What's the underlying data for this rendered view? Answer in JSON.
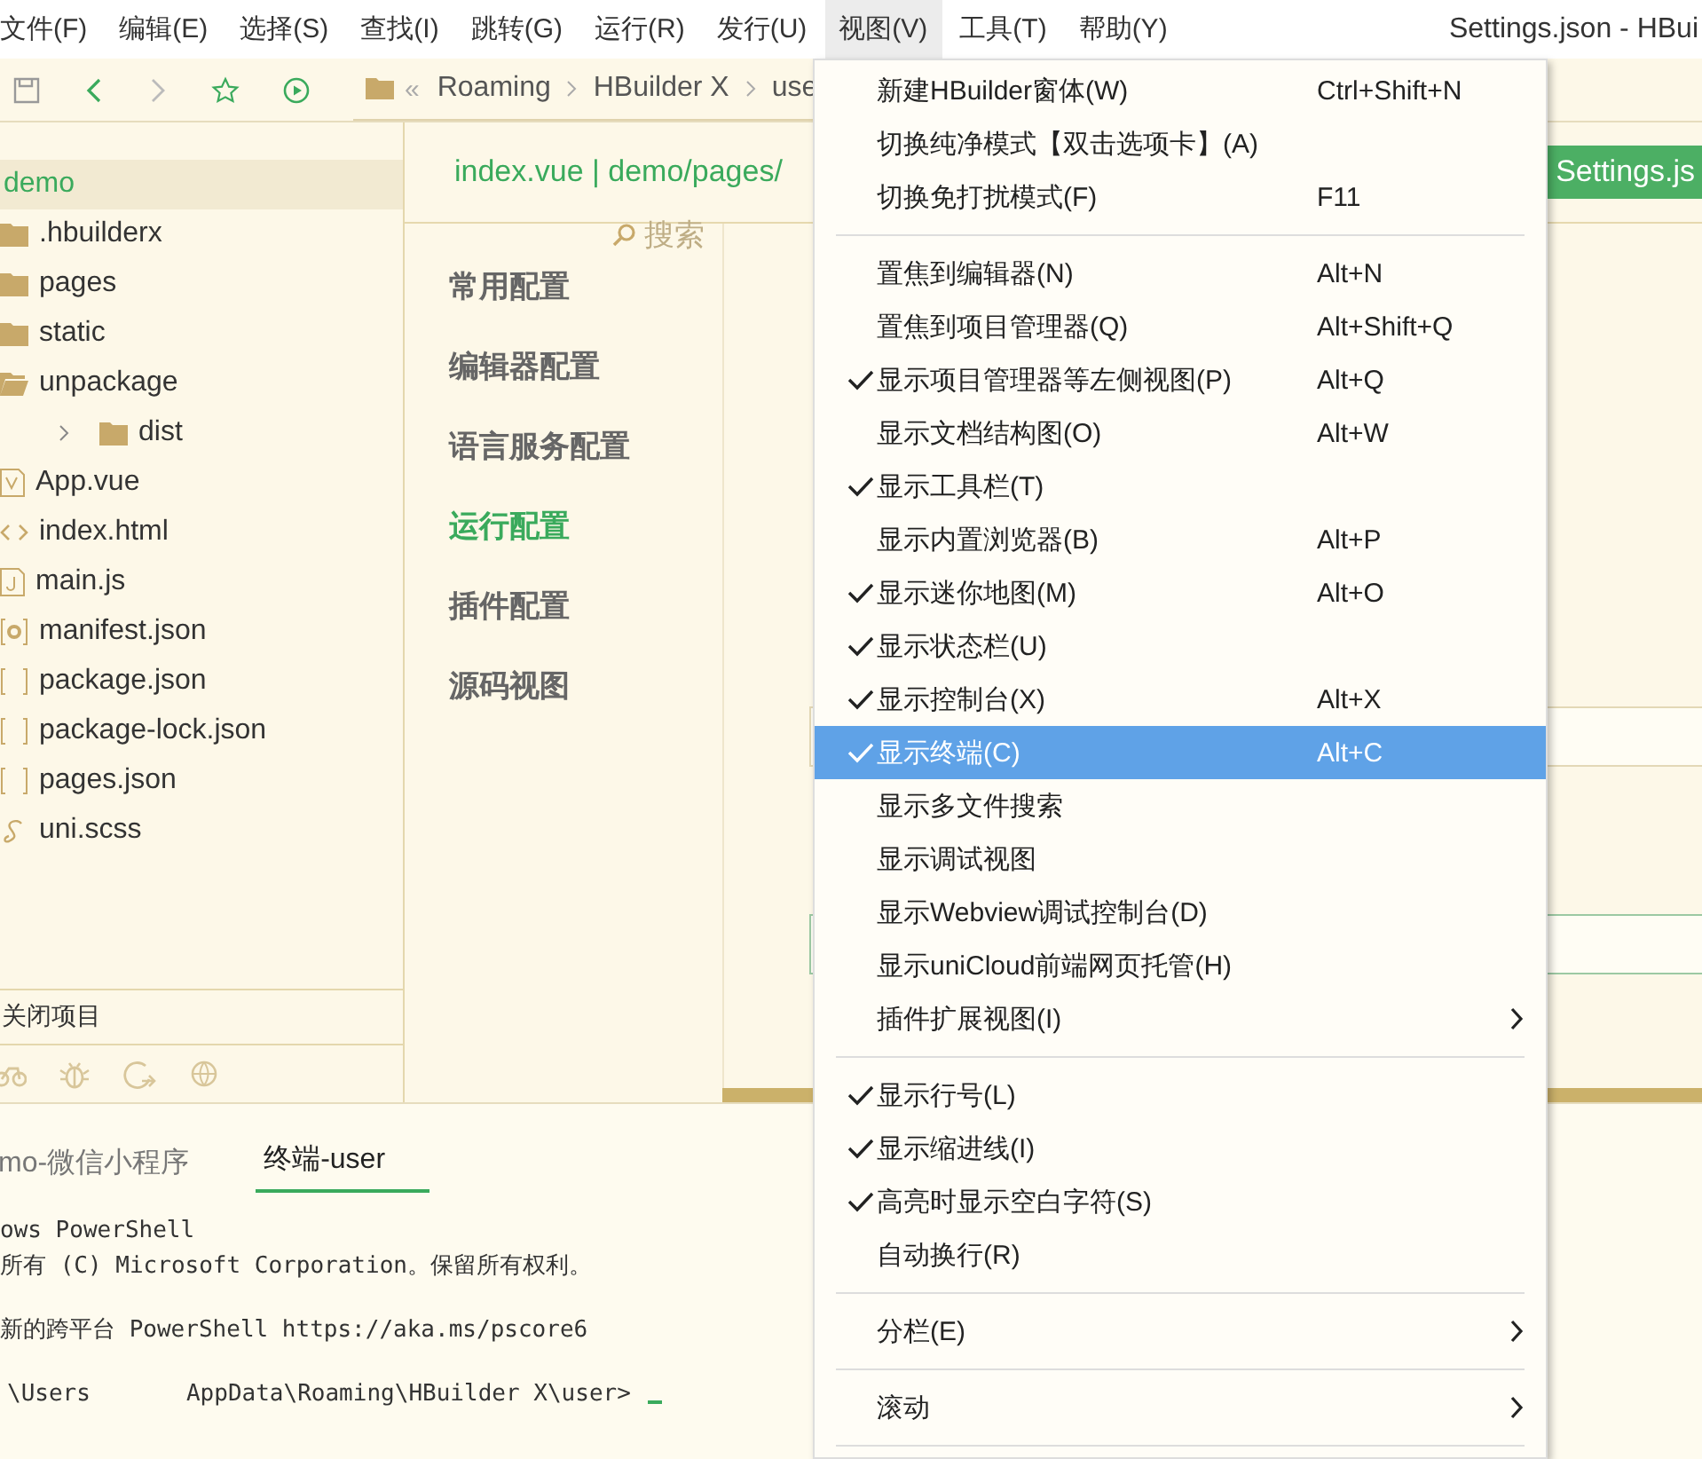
{
  "menubar": {
    "items": [
      {
        "label": "文件(F)",
        "selected": false
      },
      {
        "label": "编辑(E)",
        "selected": false
      },
      {
        "label": "选择(S)",
        "selected": false
      },
      {
        "label": "查找(I)",
        "selected": false
      },
      {
        "label": "跳转(G)",
        "selected": false
      },
      {
        "label": "运行(R)",
        "selected": false
      },
      {
        "label": "发行(U)",
        "selected": false
      },
      {
        "label": "视图(V)",
        "selected": true
      },
      {
        "label": "工具(T)",
        "selected": false
      },
      {
        "label": "帮助(Y)",
        "selected": false
      }
    ],
    "window_title": "Settings.json - HBui"
  },
  "toolbar": {
    "breadcrumb_mark": "«",
    "breadcrumb": [
      "Roaming",
      "HBuilder X",
      "use"
    ]
  },
  "sidebar": {
    "tree": [
      {
        "label": "demo",
        "kind": "project",
        "selected": true,
        "children": [
          {
            "label": ".hbuilderx",
            "kind": "folder",
            "selected": false
          },
          {
            "label": "pages",
            "kind": "folder",
            "selected": false
          },
          {
            "label": "static",
            "kind": "folder",
            "selected": false
          },
          {
            "label": "unpackage",
            "kind": "folder-open",
            "selected": false,
            "children": [
              {
                "label": "dist",
                "kind": "folder",
                "selected": false
              }
            ]
          },
          {
            "label": "App.vue",
            "kind": "vue",
            "selected": false
          },
          {
            "label": "index.html",
            "kind": "html",
            "selected": false
          },
          {
            "label": "main.js",
            "kind": "js",
            "selected": false
          },
          {
            "label": "manifest.json",
            "kind": "manifest",
            "selected": false
          },
          {
            "label": "package.json",
            "kind": "json",
            "selected": false
          },
          {
            "label": "package-lock.json",
            "kind": "json",
            "selected": false
          },
          {
            "label": "pages.json",
            "kind": "json",
            "selected": false
          },
          {
            "label": "uni.scss",
            "kind": "scss",
            "selected": false
          }
        ]
      }
    ],
    "close_project": "关闭项目"
  },
  "editor_tabs": [
    {
      "label": "index.vue | demo/pages/",
      "selected": false
    },
    {
      "label": "Settings.js",
      "selected": true
    }
  ],
  "settings_nav": {
    "search": "搜索",
    "items": [
      {
        "label": "常用配置",
        "selected": false
      },
      {
        "label": "编辑器配置",
        "selected": false
      },
      {
        "label": "语言服务配置",
        "selected": false
      },
      {
        "label": "运行配置",
        "selected": true
      },
      {
        "label": "插件配置",
        "selected": false
      },
      {
        "label": "源码视图",
        "selected": false
      }
    ]
  },
  "panel": {
    "tabs": [
      {
        "label": "mo-微信小程序",
        "selected": false
      },
      {
        "label": "终端-user",
        "selected": true
      }
    ],
    "terminal_lines": [
      "ows PowerShell",
      "所有 (C) Microsoft Corporation。保留所有权利。",
      "新的跨平台 PowerShell https://aka.ms/pscore6"
    ],
    "prompt_start": "\\Users",
    "prompt_end": "AppData\\Roaming\\HBuilder X\\user>"
  },
  "view_menu": {
    "items": [
      {
        "kind": "item",
        "label": "新建HBuilder窗体(W)",
        "shortcut": "Ctrl+Shift+N",
        "checked": false,
        "selected": false
      },
      {
        "kind": "item",
        "label": "切换纯净模式【双击选项卡】(A)",
        "checked": false,
        "selected": false
      },
      {
        "kind": "item",
        "label": "切换免打扰模式(F)",
        "shortcut": "F11",
        "checked": false,
        "selected": false
      },
      {
        "kind": "separator"
      },
      {
        "kind": "item",
        "label": "置焦到编辑器(N)",
        "shortcut": "Alt+N",
        "checked": false,
        "selected": false
      },
      {
        "kind": "item",
        "label": "置焦到项目管理器(Q)",
        "shortcut": "Alt+Shift+Q",
        "checked": false,
        "selected": false
      },
      {
        "kind": "item",
        "label": "显示项目管理器等左侧视图(P)",
        "shortcut": "Alt+Q",
        "checked": true,
        "selected": false
      },
      {
        "kind": "item",
        "label": "显示文档结构图(O)",
        "shortcut": "Alt+W",
        "checked": false,
        "selected": false
      },
      {
        "kind": "item",
        "label": "显示工具栏(T)",
        "checked": true,
        "selected": false
      },
      {
        "kind": "item",
        "label": "显示内置浏览器(B)",
        "shortcut": "Alt+P",
        "checked": false,
        "selected": false
      },
      {
        "kind": "item",
        "label": "显示迷你地图(M)",
        "shortcut": "Alt+O",
        "checked": true,
        "selected": false
      },
      {
        "kind": "item",
        "label": "显示状态栏(U)",
        "checked": true,
        "selected": false
      },
      {
        "kind": "item",
        "label": "显示控制台(X)",
        "shortcut": "Alt+X",
        "checked": true,
        "selected": false
      },
      {
        "kind": "item",
        "label": "显示终端(C)",
        "shortcut": "Alt+C",
        "checked": true,
        "selected": true
      },
      {
        "kind": "item",
        "label": "显示多文件搜索",
        "checked": false,
        "selected": false
      },
      {
        "kind": "item",
        "label": "显示调试视图",
        "checked": false,
        "selected": false
      },
      {
        "kind": "item",
        "label": "显示Webview调试控制台(D)",
        "checked": false,
        "selected": false
      },
      {
        "kind": "item",
        "label": "显示uniCloud前端网页托管(H)",
        "checked": false,
        "selected": false
      },
      {
        "kind": "submenu",
        "label": "插件扩展视图(I)",
        "checked": false,
        "selected": false
      },
      {
        "kind": "separator"
      },
      {
        "kind": "item",
        "label": "显示行号(L)",
        "checked": true,
        "selected": false
      },
      {
        "kind": "item",
        "label": "显示缩进线(I)",
        "checked": true,
        "selected": false
      },
      {
        "kind": "item",
        "label": "高亮时显示空白字符(S)",
        "checked": true,
        "selected": false
      },
      {
        "kind": "item",
        "label": "自动换行(R)",
        "checked": false,
        "selected": false
      },
      {
        "kind": "separator"
      },
      {
        "kind": "submenu",
        "label": "分栏(E)",
        "checked": false,
        "selected": false
      },
      {
        "kind": "separator"
      },
      {
        "kind": "submenu",
        "label": "滚动",
        "checked": false,
        "selected": false
      },
      {
        "kind": "separator"
      }
    ]
  }
}
